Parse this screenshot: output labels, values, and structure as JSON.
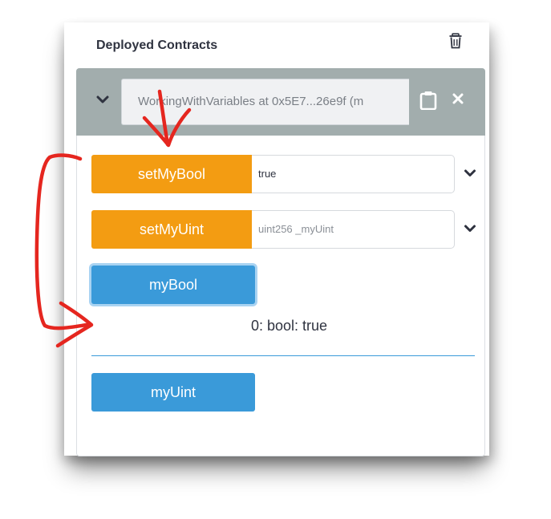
{
  "section": {
    "title": "Deployed Contracts",
    "trash_icon": "trash-icon"
  },
  "contract": {
    "name": "WorkingWithVariables at 0x5E7...26e9f (m",
    "toggle_icon": "chevron-down-icon",
    "copy_icon": "clipboard-icon",
    "close_icon": "close-icon"
  },
  "functions": [
    {
      "label": "setMyBool",
      "kind": "transact",
      "input_value": "true",
      "input_placeholder": ""
    },
    {
      "label": "setMyUint",
      "kind": "transact",
      "input_value": "",
      "input_placeholder": "uint256 _myUint"
    },
    {
      "label": "myBool",
      "kind": "call",
      "result": "0: bool: true"
    },
    {
      "label": "myUint",
      "kind": "call"
    }
  ],
  "colors": {
    "transact_button": "#f39c12",
    "call_button": "#3a9ad9",
    "header_background": "#a2adad",
    "annotation": "#e5261f"
  }
}
